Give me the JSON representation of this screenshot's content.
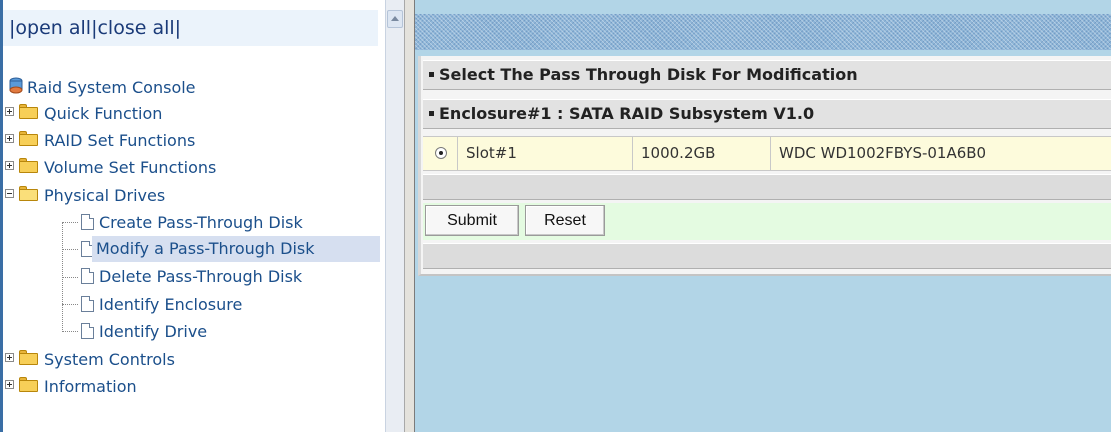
{
  "nav": {
    "open_all": "open all",
    "close_all": "close all",
    "sep": "|",
    "root": "Raid System Console",
    "items": [
      {
        "label": "Quick Function"
      },
      {
        "label": "RAID Set Functions"
      },
      {
        "label": "Volume Set Functions"
      },
      {
        "label": "Physical Drives"
      },
      {
        "label": "System Controls"
      },
      {
        "label": "Information"
      }
    ],
    "physical_children": [
      {
        "label": "Create Pass-Through Disk"
      },
      {
        "label": "Modify a Pass-Through Disk"
      },
      {
        "label": "Delete Pass-Through Disk"
      },
      {
        "label": "Identify Enclosure"
      },
      {
        "label": "Identify Drive"
      }
    ],
    "selected": "Modify a Pass-Through Disk"
  },
  "main": {
    "section_title": "Select The Pass Through Disk For Modification",
    "enclosure_title": "Enclosure#1 : SATA RAID Subsystem V1.0",
    "disk": {
      "slot": "Slot#1",
      "capacity": "1000.2GB",
      "model": "WDC WD1002FBYS-01A6B0",
      "selected": true
    },
    "submit_label": "Submit",
    "reset_label": "Reset"
  },
  "colors": {
    "main_bg": "#b2d5e7",
    "row_bg": "#fdfbdc",
    "button_row_bg": "#e4fbe1",
    "nav_text": "#1b4f8b"
  }
}
